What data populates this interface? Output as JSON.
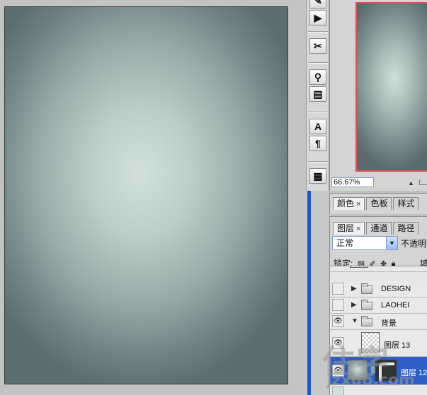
{
  "navigator": {
    "zoom": "66.67%"
  },
  "toolbar": {
    "buttons": [
      "navigator-icon",
      "play-action-icon",
      "tools-icon",
      "brush-presets-icon",
      "clone-source-icon",
      "character-icon",
      "paragraph-icon",
      "layer-comps-icon"
    ]
  },
  "color_panel": {
    "tabs": [
      {
        "label": "颜色",
        "close": "×"
      },
      {
        "label": "色板",
        "close": ""
      },
      {
        "label": "样式",
        "close": ""
      }
    ]
  },
  "layers_panel": {
    "tabs": [
      {
        "label": "图层",
        "close": "×"
      },
      {
        "label": "通道",
        "close": ""
      },
      {
        "label": "路径",
        "close": ""
      }
    ],
    "blend_mode": "正常",
    "opacity_label": "不透明",
    "lock_label": "锁定:",
    "fill_label": "填",
    "layers": [
      {
        "name": "DESIGN",
        "type": "group",
        "visible": false,
        "expanded": false
      },
      {
        "name": "LAOHEI",
        "type": "group",
        "visible": false,
        "expanded": false
      },
      {
        "name": "背景",
        "type": "group",
        "visible": true,
        "expanded": true
      },
      {
        "name": "图层 13",
        "type": "layer",
        "visible": true
      },
      {
        "name": "图层 12",
        "type": "layer",
        "visible": true,
        "selected": true
      }
    ]
  },
  "watermark": {
    "big": "住字",
    "small": "jzxuo.com"
  },
  "colors": {
    "accent_selection": "#2d5fc7",
    "navigator_frame": "#d9534a"
  }
}
